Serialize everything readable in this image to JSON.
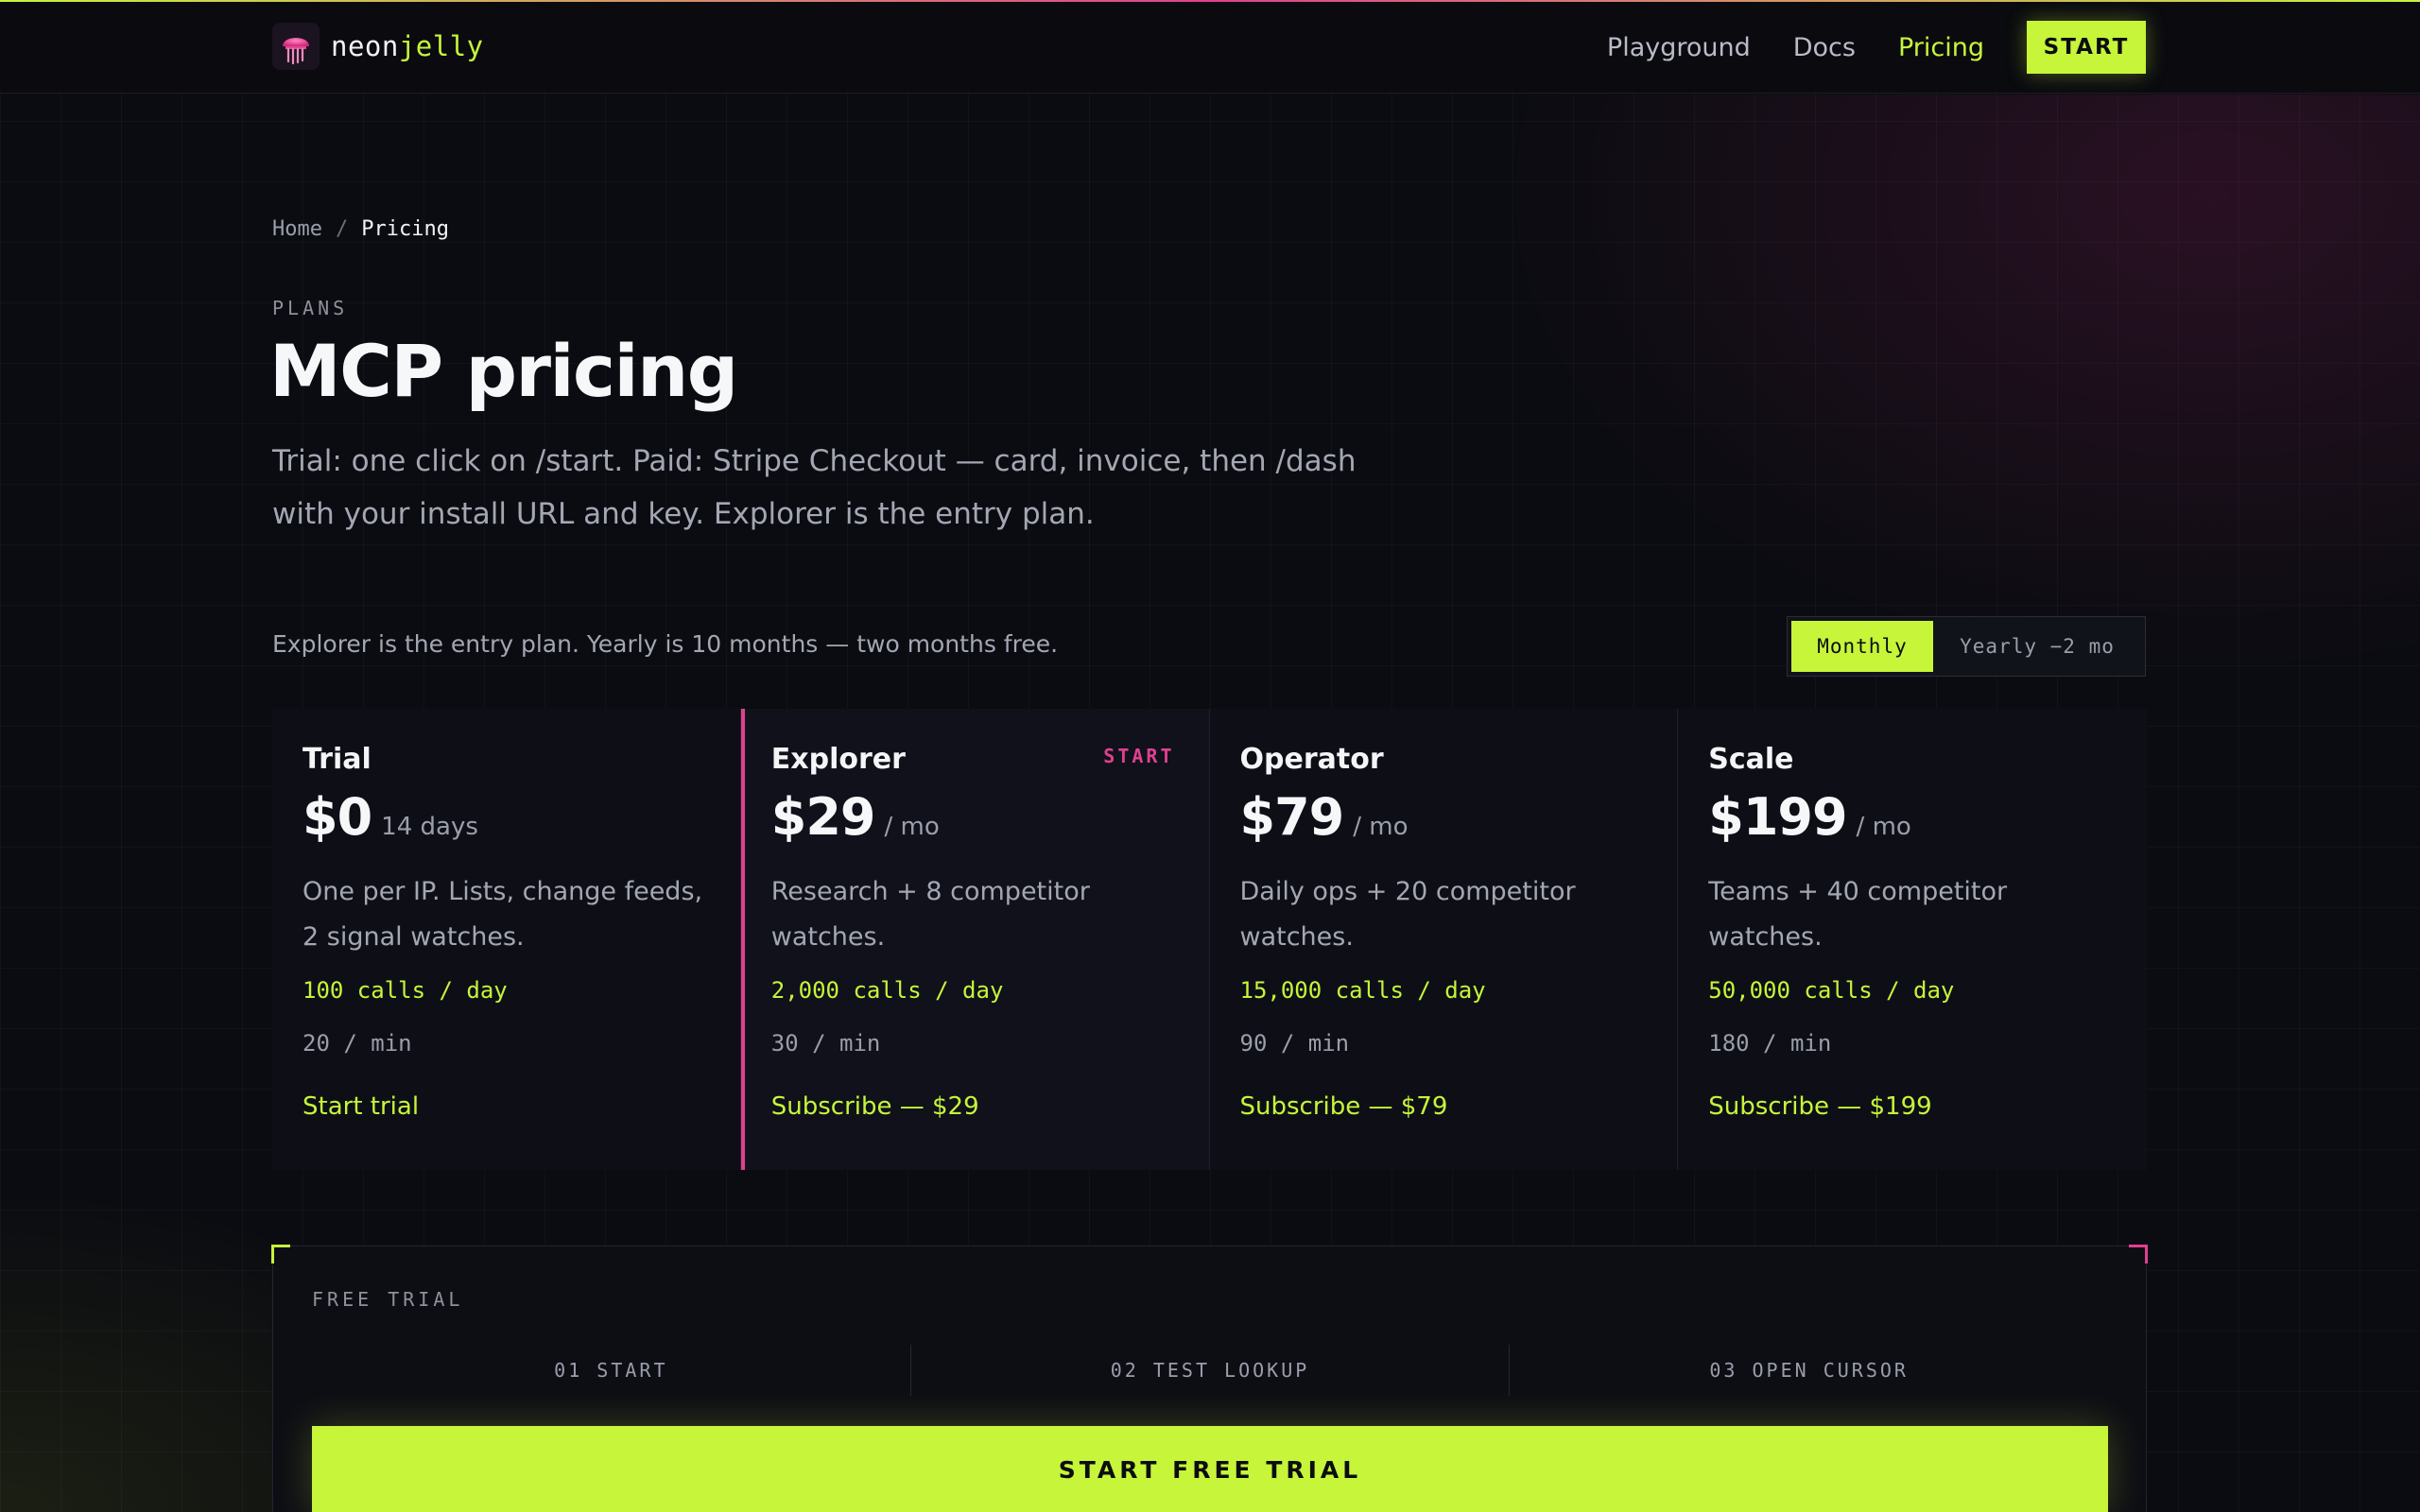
{
  "brand": {
    "name_part1": "neon",
    "name_part2": "jelly"
  },
  "nav": {
    "links": [
      "Playground",
      "Docs",
      "Pricing"
    ],
    "active": "Pricing",
    "cta": "START"
  },
  "breadcrumb": {
    "home": "Home",
    "separator": "/",
    "current": "Pricing"
  },
  "hero": {
    "eyebrow": "PLANS",
    "title": "MCP pricing",
    "lead": "Trial: one click on /start. Paid: Stripe Checkout — card, invoice, then /dash with your install URL and key. Explorer is the entry plan."
  },
  "plans_section": {
    "note": "Explorer is the entry plan. Yearly is 10 months — two months free.",
    "billing_toggle": {
      "monthly": "Monthly",
      "yearly": "Yearly −2 mo",
      "selected": "Monthly"
    }
  },
  "plans": [
    {
      "name": "Trial",
      "price": "$0",
      "period": "14 days",
      "tag": "",
      "description": "One per IP. Lists, change feeds, 2 signal watches.",
      "calls": "100 calls / day",
      "rate": "20 / min",
      "cta": "Start trial"
    },
    {
      "name": "Explorer",
      "price": "$29",
      "period": "/ mo",
      "tag": "START",
      "description": "Research + 8 competitor watches.",
      "calls": "2,000 calls / day",
      "rate": "30 / min",
      "cta": "Subscribe — $29"
    },
    {
      "name": "Operator",
      "price": "$79",
      "period": "/ mo",
      "tag": "",
      "description": "Daily ops + 20 competitor watches.",
      "calls": "15,000 calls / day",
      "rate": "90 / min",
      "cta": "Subscribe — $79"
    },
    {
      "name": "Scale",
      "price": "$199",
      "period": "/ mo",
      "tag": "",
      "description": "Teams + 40 competitor watches.",
      "calls": "50,000 calls / day",
      "rate": "180 / min",
      "cta": "Subscribe — $199"
    }
  ],
  "free_trial": {
    "eyebrow": "FREE TRIAL",
    "steps": [
      "01 START",
      "02 TEST LOOKUP",
      "03 OPEN CURSOR"
    ],
    "cta": "START FREE TRIAL"
  },
  "colors": {
    "accent": "#c6f53a",
    "highlight": "#e0408f",
    "background": "#0b0c11"
  },
  "icons": {
    "logo": "jellyfish-icon"
  }
}
